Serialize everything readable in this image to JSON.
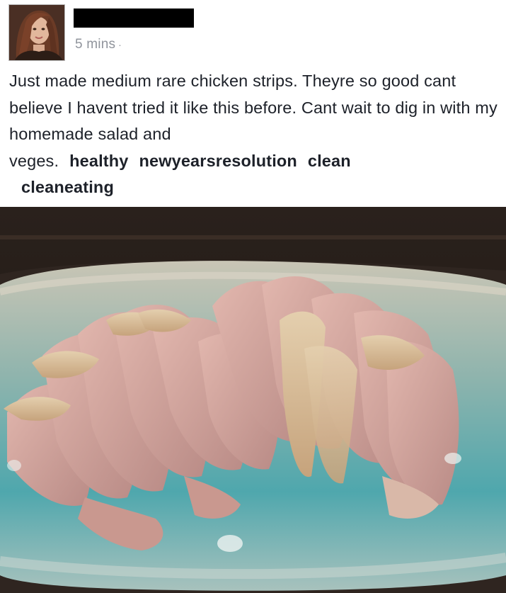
{
  "post": {
    "author_name": "",
    "timestamp": "5 mins",
    "visibility_separator": "·",
    "text": "Just made medium rare chicken strips. Theyre so good cant believe I havent tried it like this before. Cant wait to dig in with my homemade salad and veges.",
    "hashtags": [
      "healthy",
      "newyearsresolution",
      "clean",
      "cleaneating"
    ]
  },
  "photo": {
    "icon": "food-photo"
  },
  "colors": {
    "text": "#1d2129",
    "meta": "#90949c",
    "redaction": "#000000"
  }
}
